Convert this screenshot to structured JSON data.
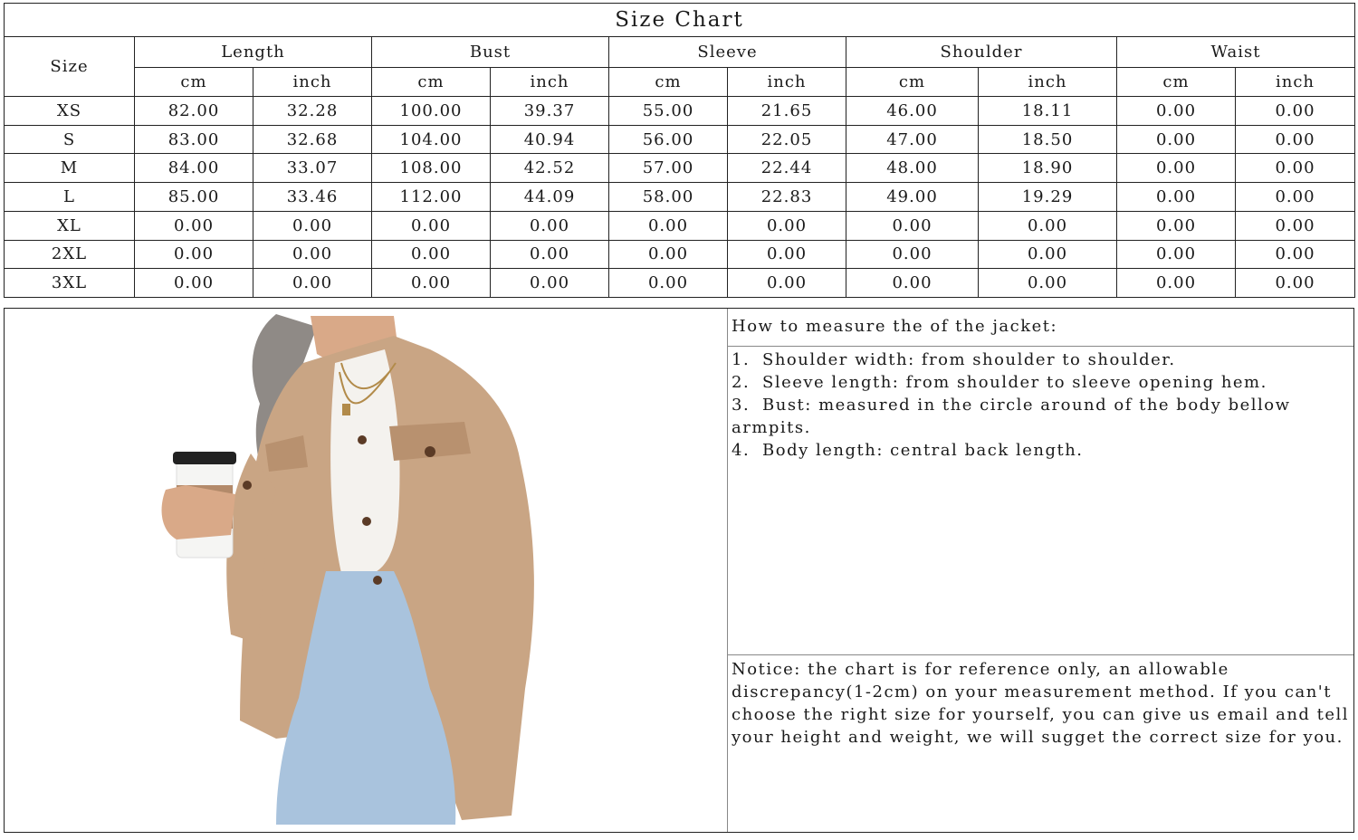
{
  "size_chart": {
    "title": "Size Chart",
    "size_header": "Size",
    "measures": [
      "Length",
      "Bust",
      "Sleeve",
      "Shoulder",
      "Waist"
    ],
    "units": [
      "cm",
      "inch"
    ],
    "rows": [
      {
        "size": "XS",
        "values": [
          "82.00",
          "32.28",
          "100.00",
          "39.37",
          "55.00",
          "21.65",
          "46.00",
          "18.11",
          "0.00",
          "0.00"
        ]
      },
      {
        "size": "S",
        "values": [
          "83.00",
          "32.68",
          "104.00",
          "40.94",
          "56.00",
          "22.05",
          "47.00",
          "18.50",
          "0.00",
          "0.00"
        ]
      },
      {
        "size": "M",
        "values": [
          "84.00",
          "33.07",
          "108.00",
          "42.52",
          "57.00",
          "22.44",
          "48.00",
          "18.90",
          "0.00",
          "0.00"
        ]
      },
      {
        "size": "L",
        "values": [
          "85.00",
          "33.46",
          "112.00",
          "44.09",
          "58.00",
          "22.83",
          "49.00",
          "19.29",
          "0.00",
          "0.00"
        ]
      },
      {
        "size": "XL",
        "values": [
          "0.00",
          "0.00",
          "0.00",
          "0.00",
          "0.00",
          "0.00",
          "0.00",
          "0.00",
          "0.00",
          "0.00"
        ]
      },
      {
        "size": "2XL",
        "values": [
          "0.00",
          "0.00",
          "0.00",
          "0.00",
          "0.00",
          "0.00",
          "0.00",
          "0.00",
          "0.00",
          "0.00"
        ]
      },
      {
        "size": "3XL",
        "values": [
          "0.00",
          "0.00",
          "0.00",
          "0.00",
          "0.00",
          "0.00",
          "0.00",
          "0.00",
          "0.00",
          "0.00"
        ]
      }
    ]
  },
  "howto": {
    "heading": "How to measure the of the jacket:",
    "items": [
      {
        "num": "1.",
        "text": "Shoulder width: from shoulder to shoulder."
      },
      {
        "num": "2.",
        "text": "Sleeve length: from shoulder to sleeve opening hem."
      },
      {
        "num": "3.",
        "text": "Bust: measured in the circle around of the body bellow armpits."
      },
      {
        "num": "4.",
        "text": "Body length: central back length."
      }
    ]
  },
  "notice": "Notice: the chart is for reference only, an allowable discrepancy(1-2cm) on your measurement method. If you can't choose the right size for yourself, you can give us email and tell your height and weight, we will sugget the correct size for you.",
  "colors": {
    "jacket": "#c9a584",
    "jeans": "#a9c3dd",
    "sweater": "#f4f2ee",
    "skin": "#d9a988",
    "hair": "#8f8a86",
    "cup_sleeve": "#b38a6a"
  }
}
